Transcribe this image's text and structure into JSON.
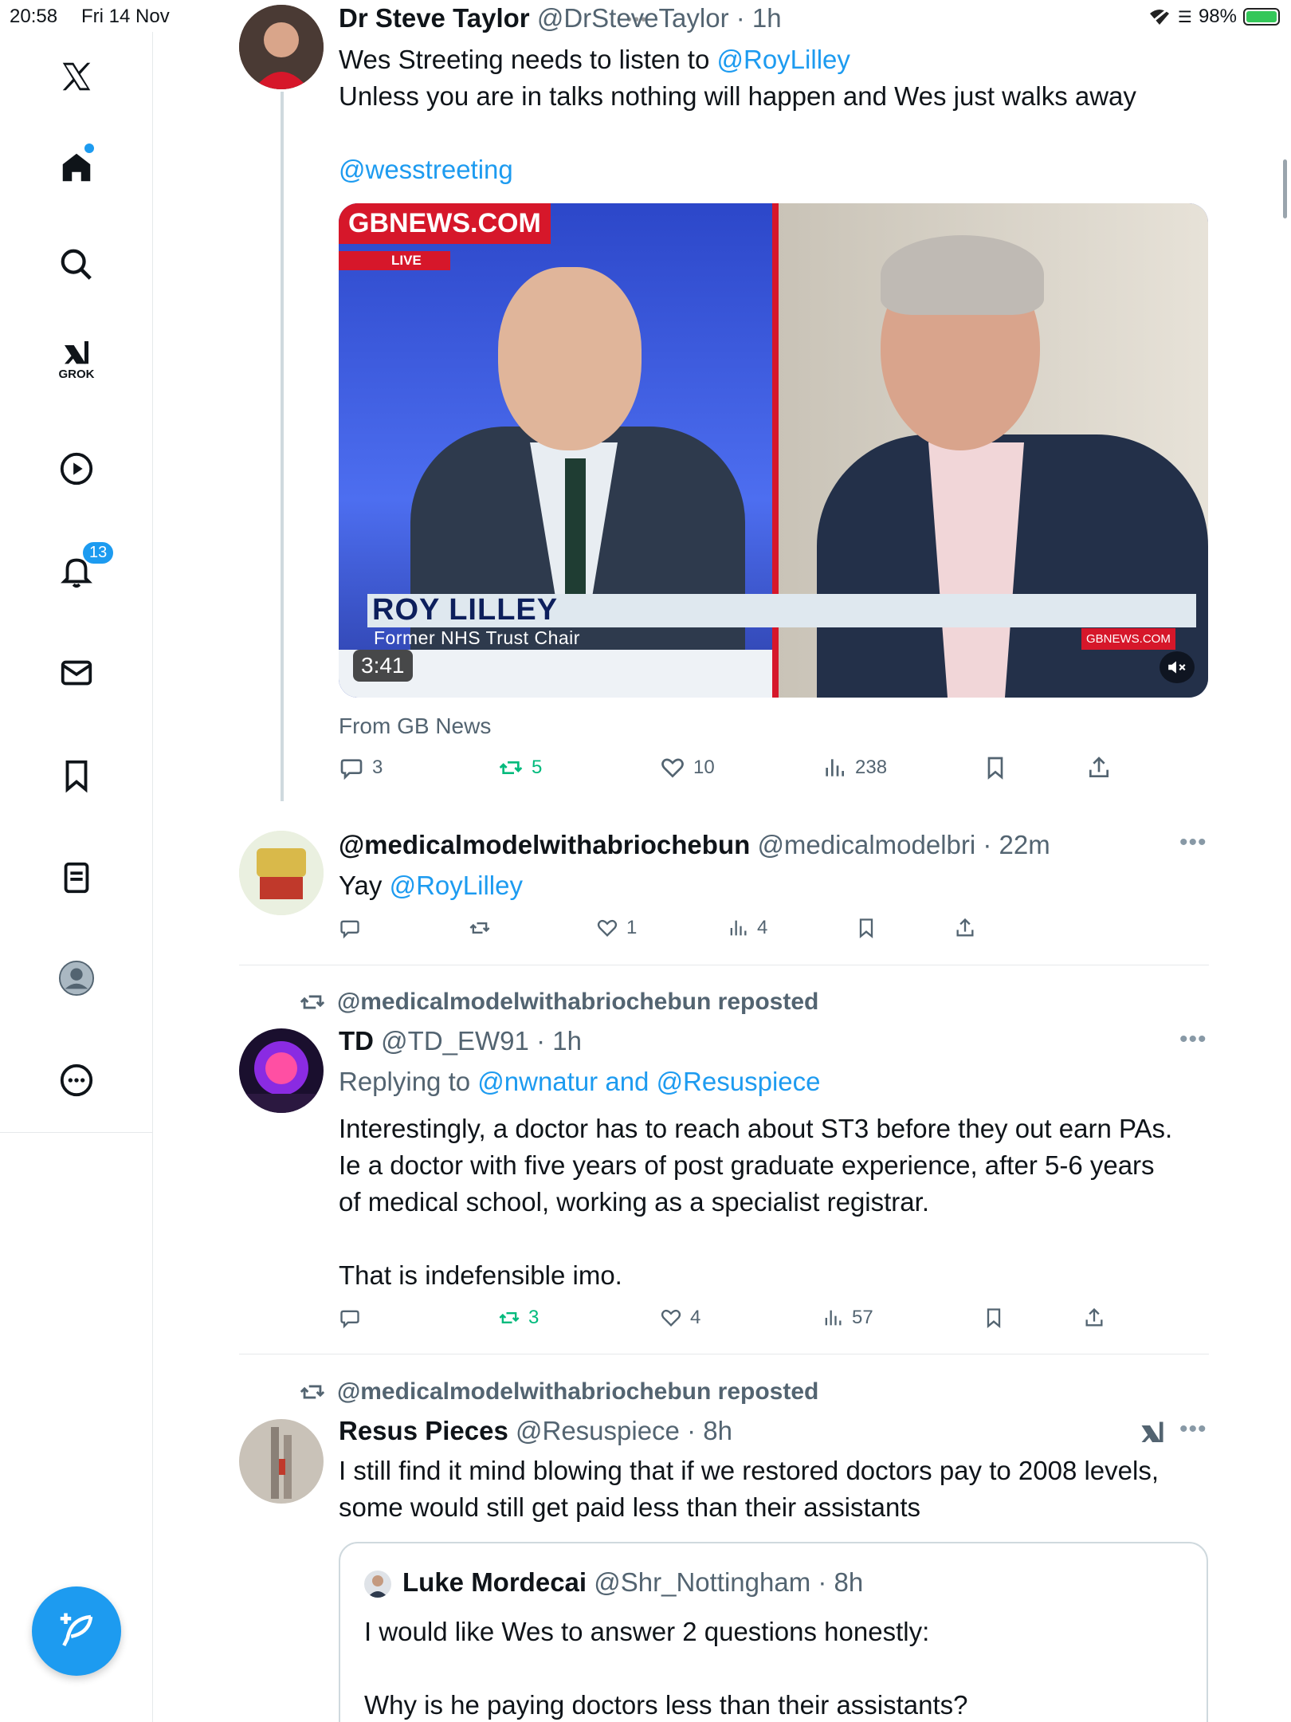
{
  "status_bar": {
    "time": "20:58",
    "date": "Fri 14 Nov",
    "battery": "98%"
  },
  "sidebar": {
    "logo": "X",
    "grok_label": "GROK",
    "notifications_badge": "13"
  },
  "tweet1": {
    "name": "Dr Steve Taylor",
    "handle": "@DrSteveTaylor",
    "time": "· 1h",
    "line1_prefix": "Wes Streeting needs to listen to ",
    "line1_mention": "@RoyLilley",
    "line2": "Unless you are in talks nothing will happen and Wes just walks away",
    "mention2": "@wesstreeting",
    "video": {
      "channel_logo": "GBNEWS.COM",
      "live": "LIVE",
      "caption_name": "ROY LILLEY",
      "caption_sub": "Former NHS Trust Chair",
      "corner_logo": "GBNEWS.COM",
      "duration": "3:41"
    },
    "source": "From GB News",
    "replies": "3",
    "reposts": "5",
    "likes": "10",
    "views": "238"
  },
  "tweet2": {
    "name": "@medicalmodelwithabriochebun",
    "handle": "@medicalmodelbri",
    "time": "· 22m",
    "text_prefix": "Yay ",
    "mention": "@RoyLilley",
    "likes": "1",
    "views": "4"
  },
  "tweet3": {
    "repost_label": "@medicalmodelwithabriochebun reposted",
    "name": "TD",
    "handle": "@TD_EW91",
    "time": "· 1h",
    "replying_prefix": "Replying to ",
    "replying_to": "@nwnatur and @Resuspiece",
    "para1_l1": "Interestingly, a doctor has to reach about ST3 before they out earn PAs.",
    "para1_l2": "Ie a doctor with five years of post graduate experience, after 5-6 years",
    "para1_l3": "of medical school, working as a specialist registrar.",
    "para2": "That is indefensible imo.",
    "reposts": "3",
    "likes": "4",
    "views": "57"
  },
  "tweet4": {
    "repost_label": "@medicalmodelwithabriochebun reposted",
    "name": "Resus Pieces",
    "handle": "@Resuspiece",
    "time": "· 8h",
    "l1": "I still find it mind blowing that if we restored doctors pay to 2008 levels,",
    "l2": "some would still get paid less than their assistants",
    "quote": {
      "name": "Luke Mordecai",
      "handle": "@Shr_Nottingham",
      "time": "· 8h",
      "l1": "I would like Wes to answer 2 questions honestly:",
      "l2": "Why is he paying doctors less than their assistants?"
    }
  },
  "colors": {
    "accent": "#1d9bf0",
    "repost_green": "#00ba7c",
    "gb_red": "#d6172a"
  }
}
